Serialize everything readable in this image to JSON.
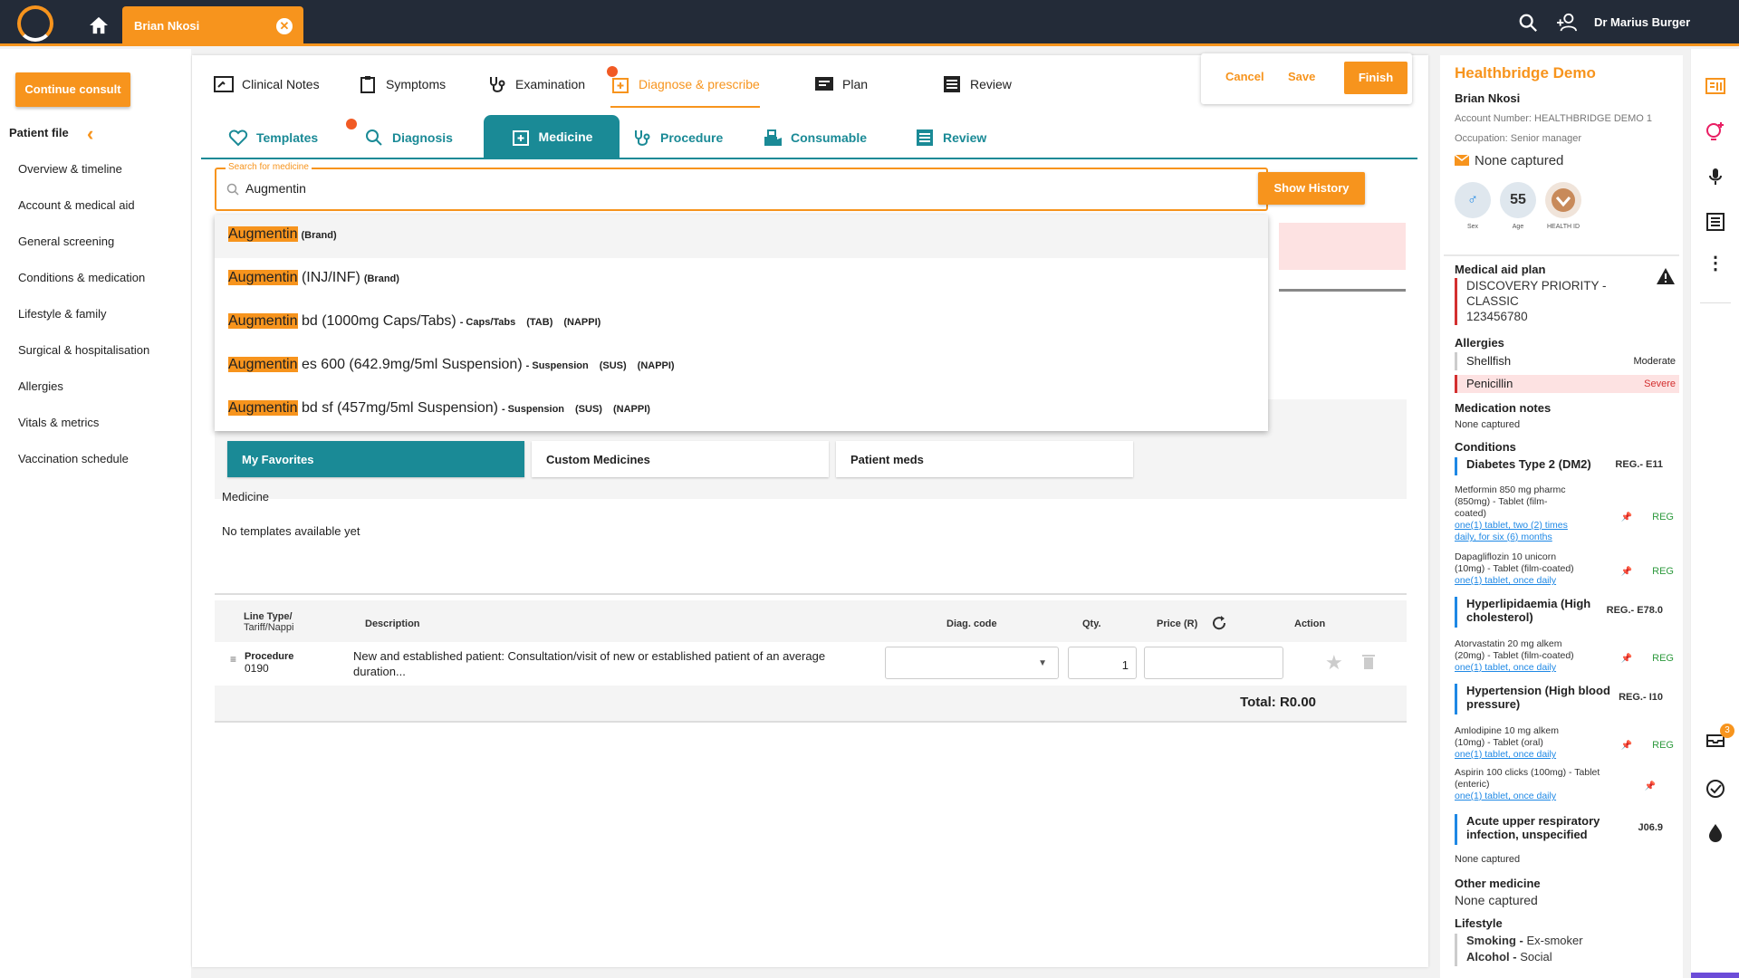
{
  "topbar": {
    "patient_tab": "Brian Nkosi",
    "user_name": "Dr Marius Burger"
  },
  "sidebar": {
    "continue_consult": "Continue consult",
    "patient_file": "Patient file",
    "items": [
      "Overview & timeline",
      "Account & medical aid",
      "General screening",
      "Conditions & medication",
      "Lifestyle & family",
      "Surgical & hospitalisation",
      "Allergies",
      "Vitals & metrics",
      "Vaccination schedule"
    ]
  },
  "main_tabs": [
    "Clinical Notes",
    "Symptoms",
    "Examination",
    "Diagnose & prescribe",
    "Plan",
    "Review"
  ],
  "actions": {
    "cancel": "Cancel",
    "save": "Save",
    "finish": "Finish"
  },
  "sub_tabs": [
    "Templates",
    "Diagnosis",
    "Medicine",
    "Procedure",
    "Consumable",
    "Review"
  ],
  "search": {
    "label": "Search for medicine",
    "value": "Augmentin",
    "show_history": "Show History"
  },
  "dropdown": [
    {
      "match": "Augmentin",
      "rest": "",
      "tags": [
        "(Brand)"
      ]
    },
    {
      "match": "Augmentin",
      "rest": " (INJ/INF)",
      "tags": [
        "(Brand)"
      ]
    },
    {
      "match": "Augmentin",
      "rest": " bd (1000mg Caps/Tabs)",
      "tags": [
        "- Caps/Tabs",
        "(TAB)",
        "(NAPPI)"
      ]
    },
    {
      "match": "Augmentin",
      "rest": " es 600 (642.9mg/5ml Suspension)",
      "tags": [
        "- Suspension",
        "(SUS)",
        "(NAPPI)"
      ]
    },
    {
      "match": "Augmentin",
      "rest": " bd sf (457mg/5ml Suspension)",
      "tags": [
        "- Suspension",
        "(SUS)",
        "(NAPPI)"
      ]
    }
  ],
  "favorites": {
    "tabs": [
      "My Favorites",
      "Custom Medicines",
      "Patient meds"
    ],
    "medicine_label": "Medicine",
    "empty": "No templates available yet"
  },
  "table": {
    "headers": {
      "line_type": "Line Type/",
      "line_type2": "Tariff/Nappi",
      "description": "Description",
      "diag_code": "Diag. code",
      "qty": "Qty.",
      "price": "Price (R)",
      "action": "Action"
    },
    "row": {
      "type": "Procedure",
      "code": "0190",
      "description": "New and established patient: Consultation/visit of new or established patient of an average",
      "description2": "duration...",
      "qty": "1"
    },
    "total": "Total: R0.00"
  },
  "patient_panel": {
    "practice": "Healthbridge Demo",
    "name": "Brian Nkosi",
    "account": "Account Number: HEALTHBRIDGE DEMO 1",
    "occupation": "Occupation: Senior manager",
    "email": "None captured",
    "age": "55",
    "sex_label": "Sex",
    "age_label": "Age",
    "health_id_label": "HEALTH ID",
    "medical_aid_title": "Medical aid plan",
    "medical_aid_1": "DISCOVERY PRIORITY -",
    "medical_aid_2": "CLASSIC",
    "medical_aid_3": "123456780",
    "allergies_title": "Allergies",
    "allergies": [
      {
        "name": "Shellfish",
        "severity": "Moderate"
      },
      {
        "name": "Penicillin",
        "severity": "Severe"
      }
    ],
    "med_notes_title": "Medication notes",
    "med_notes": "None captured",
    "conditions_title": "Conditions",
    "conditions": [
      {
        "name": "Diabetes Type 2 (DM2)",
        "code": "REG.- E11"
      },
      {
        "name": "Hyperlipidaemia (High cholesterol)",
        "code": "REG.- E78.0"
      },
      {
        "name": "Hypertension (High blood pressure)",
        "code": "REG.- I10"
      },
      {
        "name": "Acute upper respiratory infection, unspecified",
        "code": "J06.9"
      }
    ],
    "meds": [
      {
        "line1": "Metformin 850 mg pharmc",
        "line2": "(850mg) - Tablet (film-",
        "line3": "coated)",
        "link1": "one(1) tablet, two (2) times",
        "link2": "daily, for six (6) months",
        "reg": "REG"
      },
      {
        "line1": "Dapagliflozin 10 unicorn",
        "line2": "(10mg) - Tablet (film-coated)",
        "link1": "one(1) tablet, once daily",
        "reg": "REG"
      },
      {
        "line1": "Atorvastatin 20 mg alkem",
        "line2": "(20mg) - Tablet (film-coated)",
        "link1": "one(1) tablet, once daily",
        "reg": "REG"
      },
      {
        "line1": "Amlodipine 10 mg alkem",
        "line2": "(10mg) - Tablet (oral)",
        "link1": "one(1) tablet, once daily",
        "reg": "REG"
      },
      {
        "line1": "Aspirin 100 clicks (100mg) - Tablet",
        "line2": "(enteric)",
        "link1": "one(1) tablet, once daily"
      }
    ],
    "cond4_none": "None captured",
    "other_med_title": "Other medicine",
    "other_med": "None captured",
    "lifestyle_title": "Lifestyle",
    "smoking_label": "Smoking - ",
    "smoking": "Ex-smoker",
    "alcohol_label": "Alcohol - ",
    "alcohol": "Social"
  },
  "rail": {
    "notifications": "3"
  },
  "colors": {
    "accent": "#f7941d",
    "teal": "#1a8a96",
    "topbar": "#232b38",
    "condition_bar": "#1e88e5",
    "severe": "#d32f2f"
  }
}
